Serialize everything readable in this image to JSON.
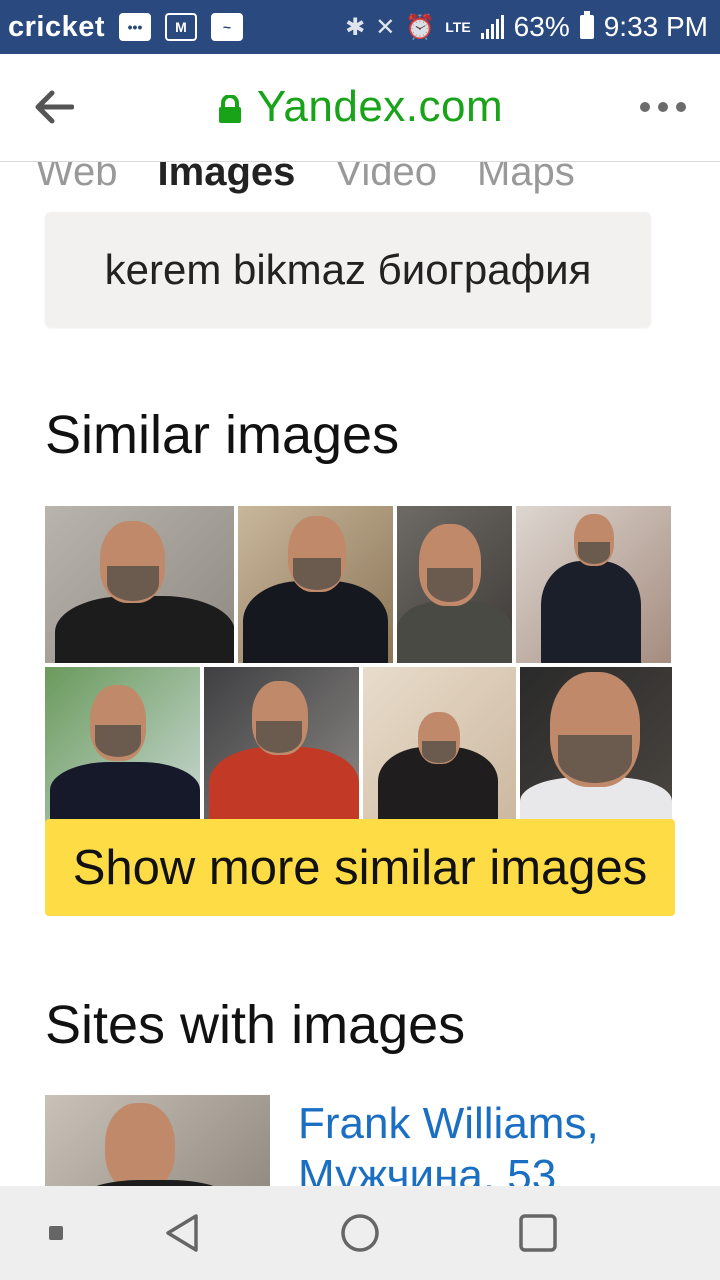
{
  "status_bar": {
    "carrier": "cricket",
    "network": "LTE",
    "battery": "63%",
    "time": "9:33 PM",
    "icons": [
      "message-icon",
      "gmail-icon",
      "app-icon",
      "bluetooth-icon",
      "mute-icon",
      "alarm-icon",
      "lte-icon",
      "signal-icon",
      "battery-icon"
    ]
  },
  "browser": {
    "url": "Yandex.com",
    "url_color": "#18a318",
    "icons": [
      "back-arrow-icon",
      "lock-icon",
      "more-icon"
    ]
  },
  "tabs": [
    {
      "label": "Web",
      "active": false
    },
    {
      "label": "Images",
      "active": true
    },
    {
      "label": "Video",
      "active": false
    },
    {
      "label": "Maps",
      "active": false
    }
  ],
  "search": {
    "query": "kerem bikmaz биография"
  },
  "similar": {
    "title": "Similar images",
    "images_count": 8,
    "show_more": "Show more similar images",
    "button_color": "#fedc46"
  },
  "sites": {
    "title": "Sites with images",
    "first_result": "Frank Williams, Мужчина, 53",
    "link_color": "#1b6fc2"
  },
  "nav": {
    "icons": [
      "recent-dot-icon",
      "back-triangle-icon",
      "home-circle-icon",
      "overview-square-icon"
    ]
  }
}
